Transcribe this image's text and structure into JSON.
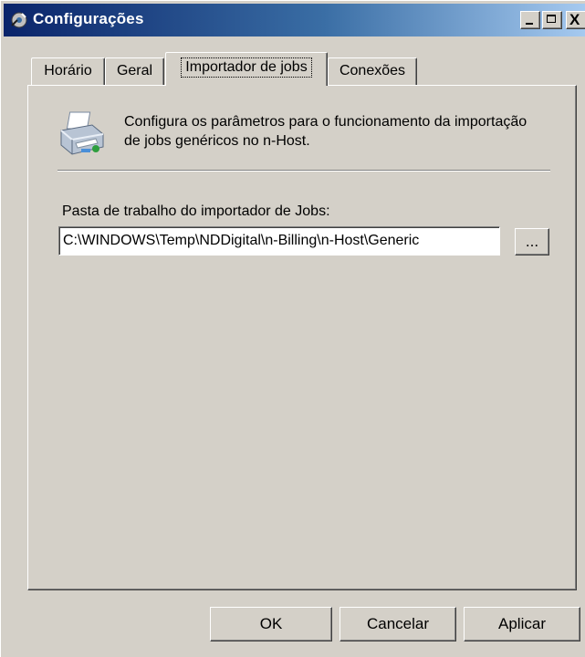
{
  "window": {
    "title": "Configurações",
    "controls": {
      "minimize": "_",
      "maximize": "□",
      "close": "X"
    }
  },
  "tabs": [
    {
      "label": "Horário",
      "active": false
    },
    {
      "label": "Geral",
      "active": false
    },
    {
      "label": "Importador de jobs",
      "active": true
    },
    {
      "label": "Conexões",
      "active": false
    }
  ],
  "panel": {
    "icon": "printer-icon",
    "description": "Configura os parâmetros para o funcionamento da importação de jobs genéricos no n-Host.",
    "field_label": "Pasta de trabalho do importador de Jobs:",
    "path_value": "C:\\WINDOWS\\Temp\\NDDigital\\n-Billing\\n-Host\\Generic",
    "browse_label": "..."
  },
  "buttons": {
    "ok": "OK",
    "cancel": "Cancelar",
    "apply": "Aplicar"
  },
  "colors": {
    "face": "#d4d0c8",
    "title_start": "#0a246a",
    "title_end": "#a6caf0"
  }
}
